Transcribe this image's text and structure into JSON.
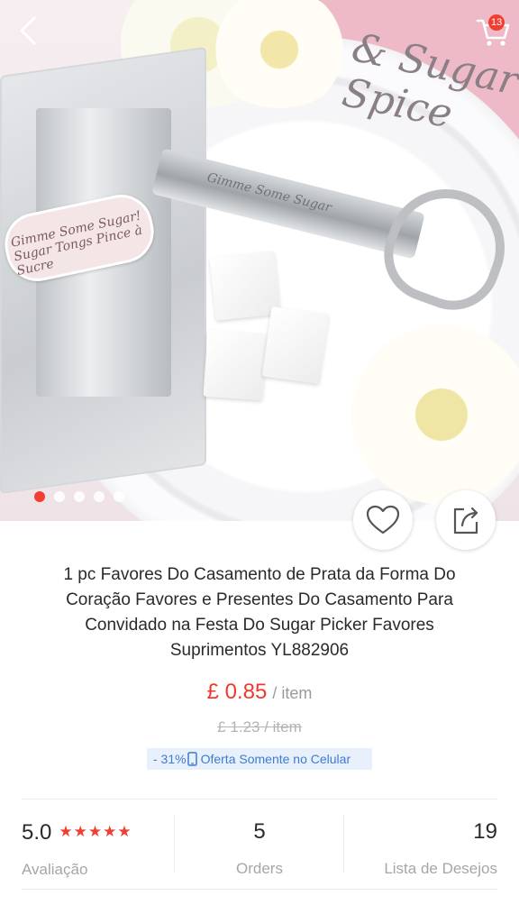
{
  "header": {
    "back_icon": "chevron-left-icon",
    "cart_icon": "shopping-cart-icon",
    "cart_count": "13"
  },
  "gallery": {
    "slide_count": 5,
    "active_index": 0,
    "image_text": {
      "jar_script": "& Sugar Spice",
      "tong_engraving": "Gimme Some Sugar",
      "tag_text": "Gimme Some Sugar! Sugar Tongs Pince à Sucre"
    }
  },
  "actions": {
    "wishlist_icon": "heart-outline-icon",
    "share_icon": "share-icon"
  },
  "product": {
    "title": "1 pc Favores Do Casamento de Prata da Forma Do Coração Favores e Presentes Do Casamento Para Convidado na Festa Do Sugar Picker Favores Suprimentos YL882906",
    "price": "£ 0.85",
    "per_item": "/ item",
    "old_price": "£ 1.23  / item",
    "discount": "- 31%",
    "mobile_offer": "Oferta Somente no Celular"
  },
  "stats": {
    "rating_value": "5.0",
    "rating_stars": 5,
    "rating_label": "Avaliação",
    "orders_value": "5",
    "orders_label": "Orders",
    "wishlist_value": "19",
    "wishlist_label": "Lista de Desejos"
  },
  "colors": {
    "accent": "#f23d31",
    "promo_text": "#3d7cd1",
    "promo_bg": "#e8f0fb"
  }
}
